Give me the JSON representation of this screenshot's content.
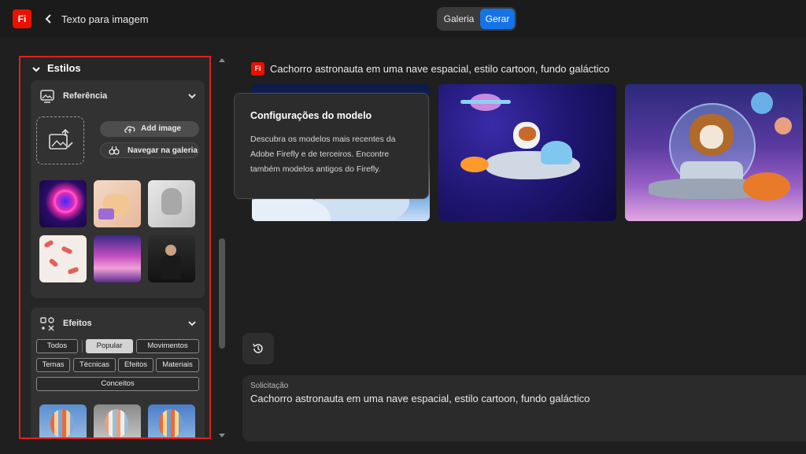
{
  "header": {
    "logo_text": "Fi",
    "title": "Texto para imagem",
    "segment": {
      "gallery": "Galeria",
      "generate": "Gerar",
      "active": "Gerar"
    }
  },
  "styles_panel": {
    "section_title": "Estilos",
    "reference": {
      "title": "Referência",
      "add_image": "Add image",
      "browse_gallery": "Navegar na galeria",
      "thumbnails": [
        "neon-ring-figure",
        "thumbs-up-3d",
        "marble-bust",
        "pink-pattern",
        "pink-clouds",
        "man-in-suit"
      ]
    },
    "effects": {
      "title": "Efeitos",
      "filters": [
        "Todos",
        "Popular",
        "Movimentos",
        "Temas",
        "Técnicas",
        "Efeitos",
        "Materiais",
        "Conceitos"
      ],
      "selected_filter": "Popular",
      "thumbnails": [
        "balloon-1",
        "balloon-2",
        "balloon-3"
      ]
    }
  },
  "main": {
    "prompt_heading": "Cachorro astronauta em uma nave espacial, estilo cartoon, fundo galáctico",
    "images": [
      "generated-image-1",
      "generated-image-2",
      "generated-image-3"
    ],
    "tooltip": {
      "title": "Configurações do modelo",
      "body": "Descubra os modelos mais recentes da Adobe Firefly e de terceiros. Encontre também modelos antigos do Firefly."
    },
    "request": {
      "label": "Solicitação",
      "text": "Cachorro astronauta em uma nave espacial, estilo cartoon, fundo galáctico"
    }
  },
  "colors": {
    "brand": "#eb1000",
    "accent": "#1473e6",
    "highlight_outline": "#e0201c"
  }
}
